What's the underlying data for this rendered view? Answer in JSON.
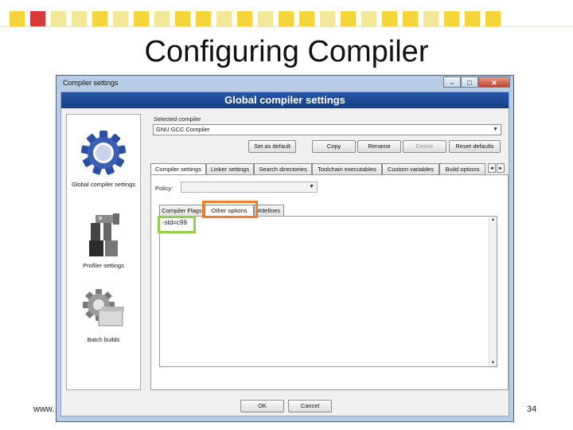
{
  "slide": {
    "title": "Configuring Compiler",
    "footer_url": "www.",
    "page_number": "34",
    "square_colors": [
      "#f5d53a",
      "#d63a3a",
      "#f3e89a",
      "#f3e89a",
      "#f5d53a",
      "#f3e89a",
      "#f5d53a",
      "#f3e89a",
      "#f5d53a",
      "#f5d53a",
      "#f3e89a",
      "#f5d53a",
      "#f3e89a",
      "#f5d53a",
      "#f5d53a",
      "#f3e89a",
      "#f5d53a",
      "#f3e89a",
      "#f5d53a",
      "#f5d53a",
      "#f3e89a",
      "#f5d53a",
      "#f5d53a",
      "#f5d53a"
    ]
  },
  "dialog": {
    "title": "Compiler settings",
    "banner": "Global compiler settings",
    "window_buttons": {
      "minimize": "–",
      "maximize": "□",
      "close": "✕"
    },
    "categories": [
      {
        "label": "Global compiler settings",
        "icon": "gear-icon"
      },
      {
        "label": "Profiler settings",
        "icon": "profiler-icon"
      },
      {
        "label": "Batch builds",
        "icon": "batch-builds-icon"
      }
    ],
    "selected_compiler_label": "Selected compiler",
    "selected_compiler_value": "GNU GCC Compiler",
    "compiler_buttons": {
      "set_default": "Set as default",
      "copy": "Copy",
      "rename": "Rename",
      "delete": "Delete",
      "reset_defaults": "Reset defaults"
    },
    "main_tabs": [
      "Compiler settings",
      "Linker settings",
      "Search directories",
      "Toolchain executables",
      "Custom variables",
      "Build options"
    ],
    "tab_nav": {
      "left": "◂",
      "right": "▸"
    },
    "policy_label": "Policy:",
    "policy_value": "",
    "sub_tabs": [
      "Compiler Flags",
      "Other options",
      "#defines"
    ],
    "other_options_text": "-std=c99",
    "footer_buttons": {
      "ok": "OK",
      "cancel": "Cancel"
    },
    "highlight_colors": {
      "other_options_tab": "#ed7d31",
      "options_text": "#92d050"
    }
  }
}
